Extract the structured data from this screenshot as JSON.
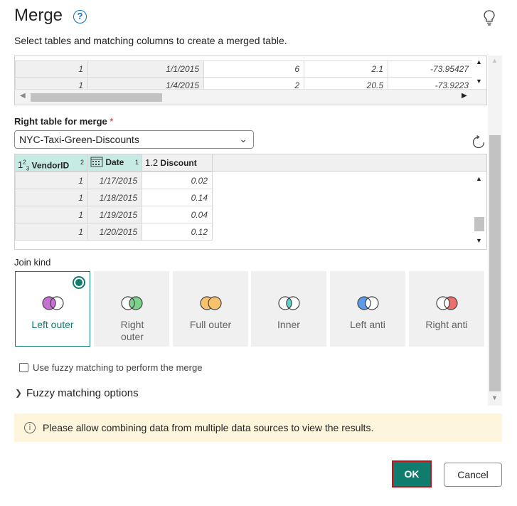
{
  "dialog": {
    "title": "Merge",
    "subtitle": "Select tables and matching columns to create a merged table."
  },
  "left_table": {
    "rows": [
      [
        "1",
        "1/1/2015",
        "6",
        "2.1",
        "-73.95427"
      ],
      [
        "1",
        "1/4/2015",
        "2",
        "20.5",
        "-73.9223"
      ]
    ]
  },
  "right_table": {
    "label": "Right table for merge",
    "required_mark": "*",
    "selected": "NYC-Taxi-Green-Discounts",
    "columns": [
      {
        "type": "1²₃",
        "name": "VendorID",
        "order": "2"
      },
      {
        "type": "calendar",
        "name": "Date",
        "order": "1"
      },
      {
        "type": "1.2",
        "name": "Discount",
        "order": ""
      }
    ],
    "rows": [
      [
        "1",
        "1/17/2015",
        "0.02"
      ],
      [
        "1",
        "1/18/2015",
        "0.14"
      ],
      [
        "1",
        "1/19/2015",
        "0.04"
      ],
      [
        "1",
        "1/20/2015",
        "0.12"
      ]
    ]
  },
  "join": {
    "label": "Join kind",
    "options": [
      {
        "label": "Left outer",
        "selected": true
      },
      {
        "label": "Right outer"
      },
      {
        "label": "Full outer"
      },
      {
        "label": "Inner"
      },
      {
        "label": "Left anti"
      },
      {
        "label": "Right anti"
      }
    ]
  },
  "fuzzy": {
    "checkbox_label": "Use fuzzy matching to perform the merge",
    "options_label": "Fuzzy matching options"
  },
  "info": {
    "message": "Please allow combining data from multiple data sources to view the results."
  },
  "buttons": {
    "ok": "OK",
    "cancel": "Cancel"
  },
  "colors": {
    "accent": "#107c6d",
    "highlight_border": "#c50f1f",
    "info_bg": "#fdf6dd"
  }
}
